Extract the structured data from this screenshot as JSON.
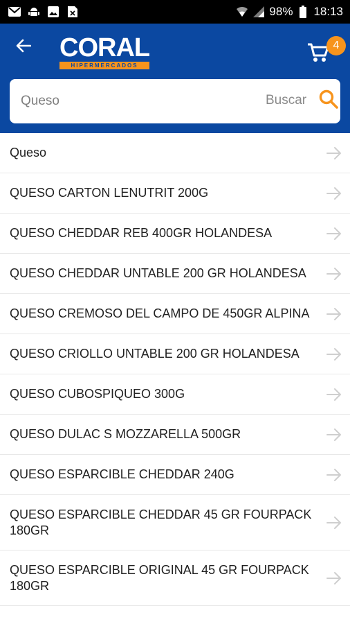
{
  "status_bar": {
    "battery": "98%",
    "time": "18:13",
    "icons": [
      "mail-icon",
      "android-icon",
      "image-icon",
      "file-icon",
      "wifi-icon",
      "signal-icon",
      "battery-icon"
    ]
  },
  "app_bar": {
    "back_icon": "arrow-left-icon",
    "logo_text": "CORAL",
    "logo_subtext": "HIPERMERCADOS",
    "cart_badge": "4",
    "brand_color": "#0b48a1",
    "accent_color": "#f7941d"
  },
  "search": {
    "value": "Queso",
    "placeholder": "",
    "button_label": "Buscar"
  },
  "suggestions": [
    "Queso",
    "QUESO CARTON LENUTRIT 200G",
    "QUESO CHEDDAR REB 400GR HOLANDESA",
    "QUESO CHEDDAR UNTABLE 200 GR HOLANDESA",
    "QUESO CREMOSO DEL CAMPO DE 450GR ALPINA",
    "QUESO CRIOLLO UNTABLE 200 GR HOLANDESA",
    "QUESO CUBOSPIQUEO 300G",
    "QUESO DULAC S MOZZARELLA 500GR",
    "QUESO ESPARCIBLE CHEDDAR 240G",
    "QUESO ESPARCIBLE CHEDDAR 45 GR FOURPACK 180GR",
    "QUESO ESPARCIBLE ORIGINAL 45 GR FOURPACK 180GR"
  ]
}
